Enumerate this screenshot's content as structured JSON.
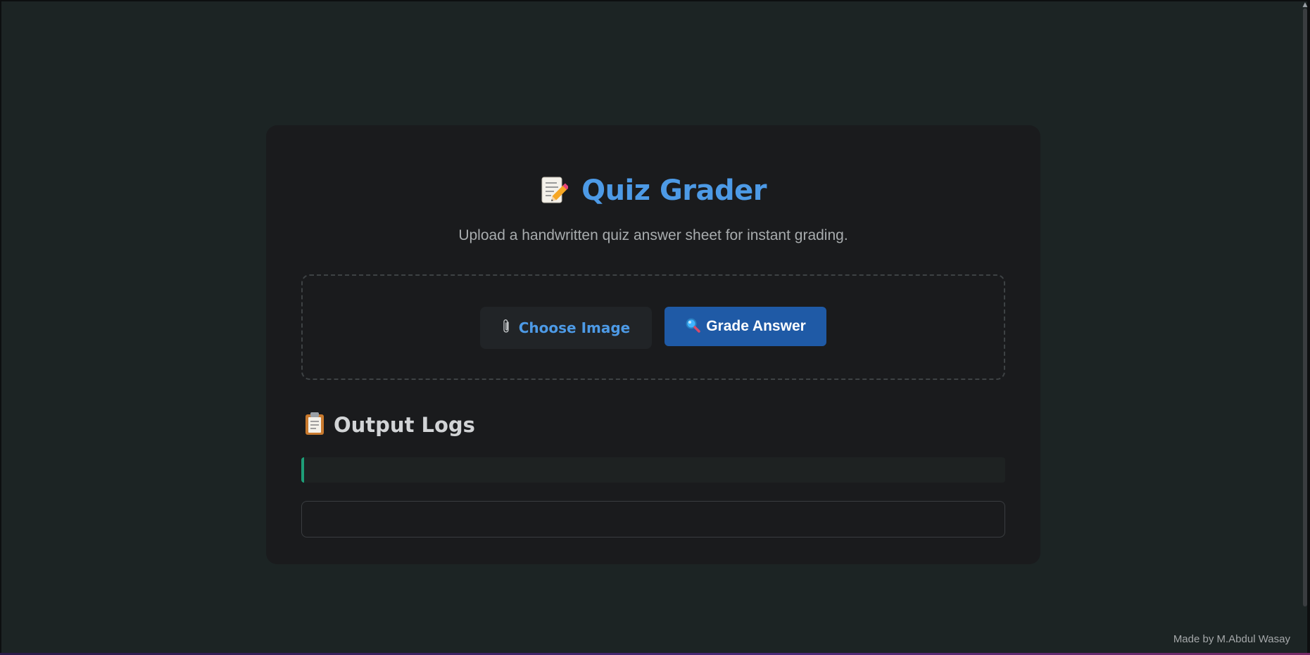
{
  "header": {
    "title": "Quiz Grader",
    "title_icon": "memo-icon",
    "subtitle": "Upload a handwritten quiz answer sheet for instant grading."
  },
  "upload": {
    "choose_label": "Choose Image",
    "choose_icon": "paperclip-icon",
    "grade_label": "Grade Answer",
    "grade_icon": "magnifier-icon"
  },
  "logs": {
    "title": "Output Logs",
    "icon": "clipboard-icon",
    "log_text": "",
    "output_text": ""
  },
  "footer": {
    "credit": "Made by M.Abdul Wasay"
  },
  "colors": {
    "background": "#1c2424",
    "card": "#1a1b1d",
    "accent_blue": "#4d9ae6",
    "button_blue": "#1f5aa6",
    "log_accent_green": "#1e9e78"
  }
}
